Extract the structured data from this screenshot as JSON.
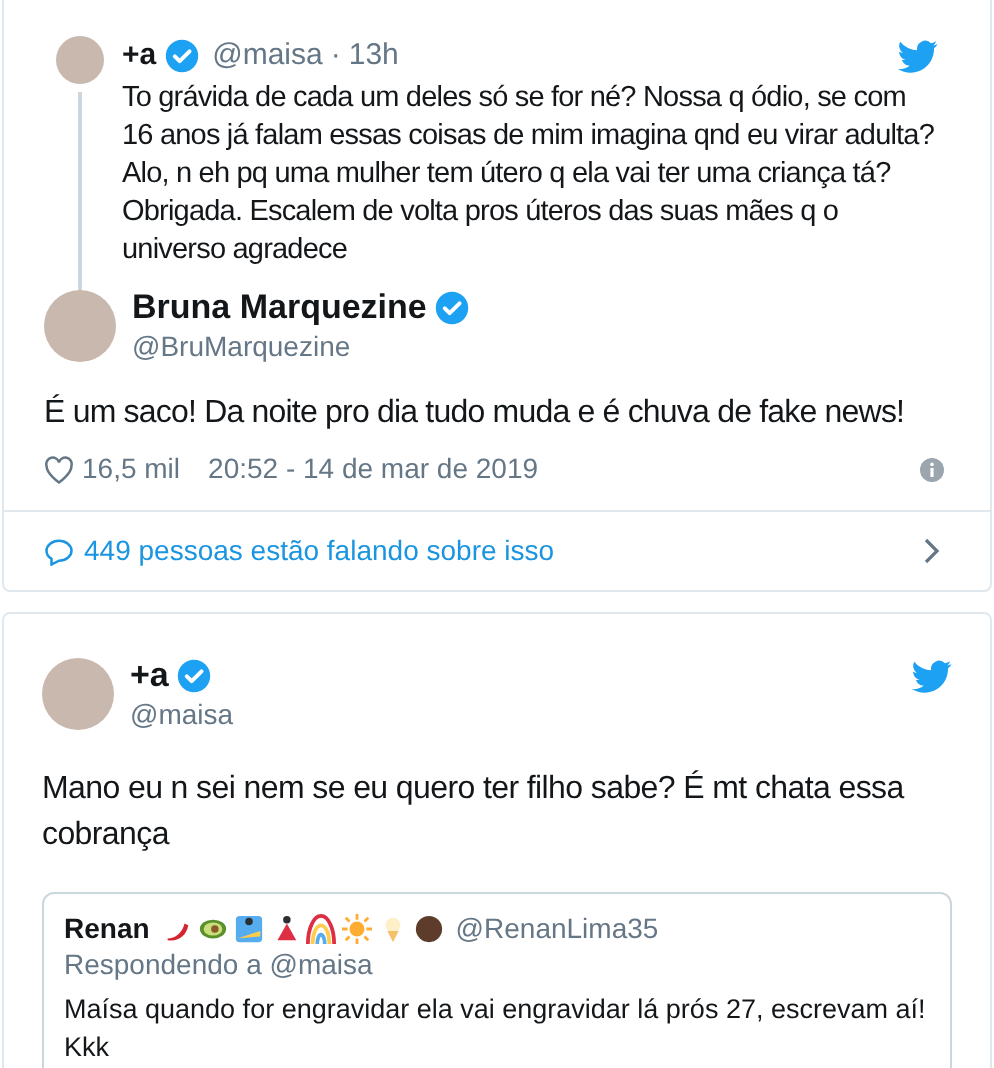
{
  "thread_card": {
    "reply_tweet": {
      "name": "+a",
      "verified": true,
      "handle": "@maisa",
      "separator": "·",
      "time": "13h",
      "text": "To grávida de cada um deles só se for né? Nossa q ódio, se com 16 anos já falam essas coisas de mim imagina qnd eu virar adulta? Alo, n eh pq uma mulher tem útero q ela vai ter uma criança tá? Obrigada. Escalem de volta pros úteros das suas mães q o universo agradece"
    },
    "main_tweet": {
      "name": "Bruna Marquezine",
      "verified": true,
      "handle": "@BruMarquezine",
      "text": "É um saco! Da noite pro dia tudo muda e é chuva de fake news!",
      "likes": "16,5 mil",
      "timestamp": "20:52 - 14 de mar de 2019"
    },
    "conversation_link": "449 pessoas estão falando sobre isso"
  },
  "tweet_card": {
    "name": "+a",
    "verified": true,
    "handle": "@maisa",
    "text": "Mano eu n sei nem se eu quero ter filho sabe? É mt chata essa cobrança",
    "quoted": {
      "name": "Renan",
      "handle": "@RenanLima35",
      "replying_to": "Respondendo a @maisa",
      "text": "Maísa quando for engravidar ela vai engravidar lá prós 27, escrevam aí! Kkk"
    }
  }
}
